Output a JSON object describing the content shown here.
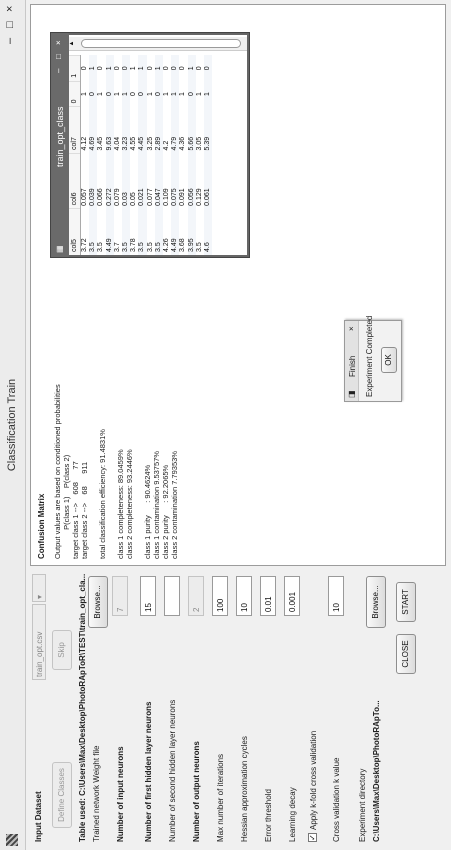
{
  "window": {
    "title": "Classification Train",
    "min_symbol": "–",
    "max_symbol": "□",
    "close_symbol": "×"
  },
  "left": {
    "input_dataset_label": "Input Dataset",
    "dataset_select_value": "train_opt.csv",
    "define_classes_label": "Define Classes",
    "skip_label": "Skip",
    "table_used": "Table used: C:\\Users\\Max\\Desktop\\PhotoRApToR\\TEST\\train_opt_cla...",
    "trained_weight_label": "Trained network Weight file",
    "browse_label": "Browse...",
    "input_neurons_label": "Number of input neurons",
    "input_neurons_value": "7",
    "first_hidden_label": "Number of first hidden layer neurons",
    "first_hidden_value": "15",
    "second_hidden_label": "Number of second hidden layer neurons",
    "second_hidden_value": "",
    "output_neurons_label": "Number of output neurons",
    "output_neurons_value": "2",
    "max_iter_label": "Max number of iterations",
    "max_iter_value": "100",
    "hessian_label": "Hessian approximation cycles",
    "hessian_value": "10",
    "error_label": "Error threshold",
    "error_value": "0.01",
    "decay_label": "Learning decay",
    "decay_value": "0.001",
    "kfold_label": "Apply k-fold cross validation",
    "kfold_check": "✓",
    "kvalue_label": "Cross validation k value",
    "kvalue_value": "10",
    "exp_dir_label": "Experiment directory",
    "exp_dir_path": "C:\\Users\\Max\\Desktop\\PhotoRApTo...",
    "browse2_label": "Browse...",
    "close_label": "CLOSE",
    "start_label": "START"
  },
  "confusion": {
    "title": "Confusion Matrix",
    "lines": [
      "Output values are based on conditioned probabilities",
      "              P(class 1)    P(class 2)",
      "target class 1 -->    608      77",
      "target class 2 -->    68      911",
      "",
      "total classification efficiency: 91.4831%",
      "",
      "class 1 completeness: 89.0459%",
      "class 2 completeness: 93.2446%",
      "",
      "class 1 purity      : 90.4624%",
      "class 1 contamination 9.53757%",
      "class 2 purity      : 92.2065%",
      "class 2 contamination 7.79353%"
    ]
  },
  "finish_dialog": {
    "title": "Finish",
    "message": "Experiment Completed",
    "ok_label": "OK",
    "close_symbol": "×"
  },
  "table_window": {
    "title": "train_opt_class",
    "columns": [
      "col5",
      "col6",
      "col7",
      "0",
      "1"
    ],
    "rows": [
      [
        "3.72",
        "0.057",
        "4.12",
        "1",
        "0"
      ],
      [
        "3.5",
        "0.039",
        "4.69",
        "0",
        "1"
      ],
      [
        "3.5",
        "0.066",
        "3.45",
        "1",
        "0"
      ],
      [
        "4.49",
        "0.272",
        "9.63",
        "0",
        "1"
      ],
      [
        "3.7",
        "0.079",
        "4.04",
        "1",
        "0"
      ],
      [
        "3.5",
        "0.03",
        "3.23",
        "1",
        "0"
      ],
      [
        "3.78",
        "0.05",
        "4.55",
        "0",
        "1"
      ],
      [
        "3.5",
        "0.021",
        "4.45",
        "0",
        "1"
      ],
      [
        "3.5",
        "0.077",
        "3.25",
        "1",
        "0"
      ],
      [
        "3.5",
        "0.047",
        "2.89",
        "0",
        "1"
      ],
      [
        "4.26",
        "0.109",
        "4.2",
        "1",
        "0"
      ],
      [
        "4.49",
        "0.075",
        "4.79",
        "1",
        "0"
      ],
      [
        "3.68",
        "0.091",
        "4.36",
        "1",
        "0"
      ],
      [
        "3.95",
        "0.056",
        "5.66",
        "0",
        "1"
      ],
      [
        "3.5",
        "0.129",
        "3.05",
        "1",
        "0"
      ],
      [
        "4.6",
        "0.061",
        "5.39",
        "1",
        "0"
      ]
    ]
  }
}
